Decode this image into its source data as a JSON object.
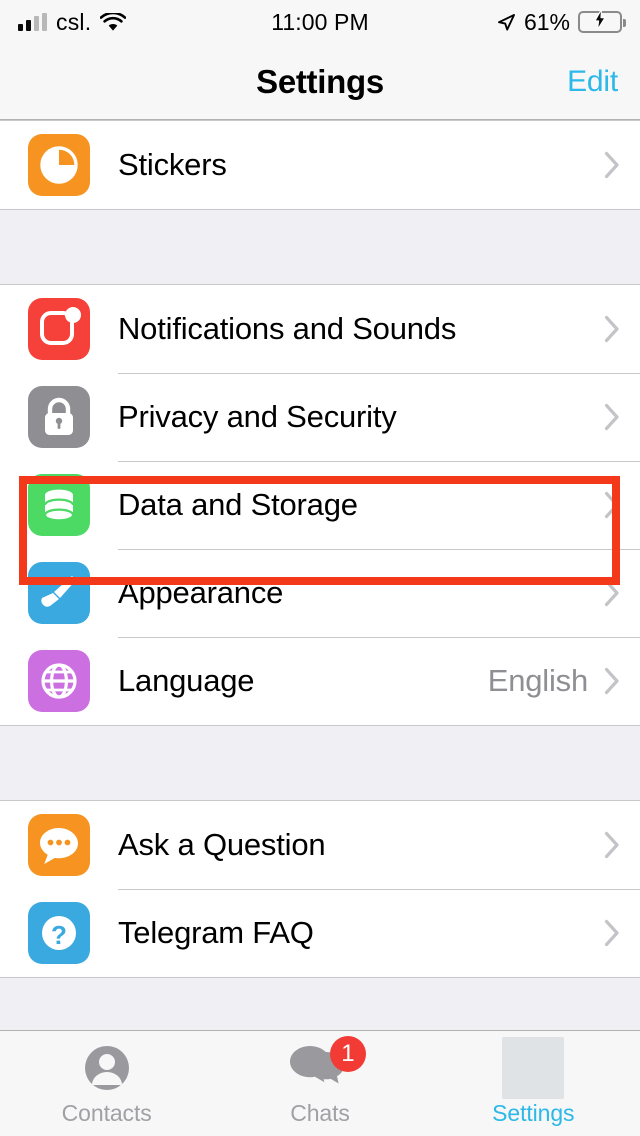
{
  "status_bar": {
    "carrier": "csl.",
    "wifi_icon": "wifi-icon",
    "time": "11:00 PM",
    "location_icon": "location-arrow-icon",
    "battery_percent": "61%",
    "battery_level": 61,
    "charging": true
  },
  "nav": {
    "title": "Settings",
    "edit_label": "Edit",
    "edit_color": "#2cb8e8"
  },
  "sections": [
    {
      "id": "stickers-section",
      "rows": [
        {
          "id": "stickers",
          "label": "Stickers",
          "icon": "stickers-icon",
          "icon_color": "#f79421",
          "value": "",
          "chevron": true
        }
      ]
    },
    {
      "id": "preferences-section",
      "rows": [
        {
          "id": "notifications-and-sounds",
          "label": "Notifications and Sounds",
          "icon": "notifications-icon",
          "icon_color": "#f6413a",
          "value": "",
          "chevron": true
        },
        {
          "id": "privacy-and-security",
          "label": "Privacy and Security",
          "icon": "lock-icon",
          "icon_color": "#8e8e93",
          "value": "",
          "chevron": true,
          "highlighted": true
        },
        {
          "id": "data-and-storage",
          "label": "Data and Storage",
          "icon": "database-icon",
          "icon_color": "#4cd964",
          "value": "",
          "chevron": true
        },
        {
          "id": "appearance",
          "label": "Appearance",
          "icon": "paintbrush-icon",
          "icon_color": "#3aa9e0",
          "value": "",
          "chevron": true
        },
        {
          "id": "language",
          "label": "Language",
          "icon": "globe-icon",
          "icon_color": "#cc6fe0",
          "value": "English",
          "chevron": true
        }
      ]
    },
    {
      "id": "help-section",
      "rows": [
        {
          "id": "ask-a-question",
          "label": "Ask a Question",
          "icon": "speech-bubble-icon",
          "icon_color": "#f79421",
          "value": "",
          "chevron": true
        },
        {
          "id": "telegram-faq",
          "label": "Telegram FAQ",
          "icon": "question-mark-icon",
          "icon_color": "#3aa9e0",
          "value": "",
          "chevron": true
        }
      ]
    }
  ],
  "highlight": {
    "target": "privacy-and-security",
    "color": "#f4381a"
  },
  "tabbar": {
    "tabs": [
      {
        "id": "contacts",
        "label": "Contacts",
        "icon": "person-icon",
        "active": false,
        "badge": ""
      },
      {
        "id": "chats",
        "label": "Chats",
        "icon": "chat-bubbles-icon",
        "active": false,
        "badge": "1"
      },
      {
        "id": "settings",
        "label": "Settings",
        "icon": "settings-icon-placeholder",
        "active": true,
        "badge": ""
      }
    ]
  }
}
